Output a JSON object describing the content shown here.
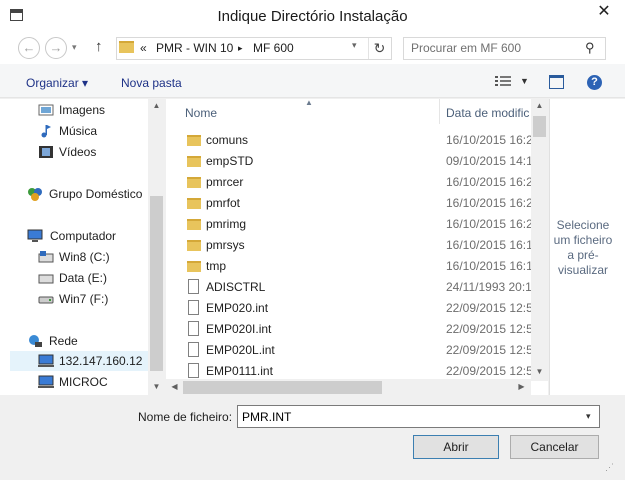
{
  "window": {
    "title": "Indique Directório Instalação",
    "close": "✕"
  },
  "address": {
    "chevron": "«",
    "crumbs": [
      "PMR - WIN 10",
      "MF 600"
    ]
  },
  "search": {
    "placeholder": "Procurar em MF 600"
  },
  "toolbar": {
    "organize": "Organizar ▾",
    "new_folder": "Nova pasta"
  },
  "nav": {
    "items": [
      {
        "label": "Imagens",
        "icon": "pictures-icon"
      },
      {
        "label": "Música",
        "icon": "music-icon"
      },
      {
        "label": "Vídeos",
        "icon": "videos-icon"
      },
      {
        "label": "Grupo Doméstico",
        "icon": "homegroup-icon"
      },
      {
        "label": "Computador",
        "icon": "computer-icon"
      },
      {
        "label": "Win8 (C:)",
        "icon": "drive-icon"
      },
      {
        "label": "Data (E:)",
        "icon": "drive-icon"
      },
      {
        "label": "Win7 (F:)",
        "icon": "removable-drive-icon"
      },
      {
        "label": "Rede",
        "icon": "network-icon"
      },
      {
        "label": "132.147.160.12",
        "icon": "network-computer-icon"
      },
      {
        "label": "MICROC",
        "icon": "network-computer-icon"
      }
    ]
  },
  "list": {
    "columns": {
      "name": "Nome",
      "date": "Data de modific"
    },
    "rows": [
      {
        "name": "comuns",
        "date": "16/10/2015 16:2",
        "type": "folder"
      },
      {
        "name": "empSTD",
        "date": "09/10/2015 14:1",
        "type": "folder"
      },
      {
        "name": "pmrcer",
        "date": "16/10/2015 16:2",
        "type": "folder"
      },
      {
        "name": "pmrfot",
        "date": "16/10/2015 16:2",
        "type": "folder"
      },
      {
        "name": "pmrimg",
        "date": "16/10/2015 16:2",
        "type": "folder"
      },
      {
        "name": "pmrsys",
        "date": "16/10/2015 16:1",
        "type": "folder"
      },
      {
        "name": "tmp",
        "date": "16/10/2015 16:1",
        "type": "folder"
      },
      {
        "name": "ADISCTRL",
        "date": "24/11/1993 20:1",
        "type": "file"
      },
      {
        "name": "EMP020.int",
        "date": "22/09/2015 12:5",
        "type": "file"
      },
      {
        "name": "EMP020I.int",
        "date": "22/09/2015 12:5",
        "type": "file"
      },
      {
        "name": "EMP020L.int",
        "date": "22/09/2015 12:5",
        "type": "file"
      },
      {
        "name": "EMP0111.int",
        "date": "22/09/2015 12:5",
        "type": "file"
      }
    ]
  },
  "preview": {
    "text": "Selecione um ficheiro a pré-visualizar"
  },
  "bottom": {
    "filename_label": "Nome de ficheiro:",
    "filename_value": "PMR.INT",
    "open": "Abrir",
    "cancel": "Cancelar"
  }
}
